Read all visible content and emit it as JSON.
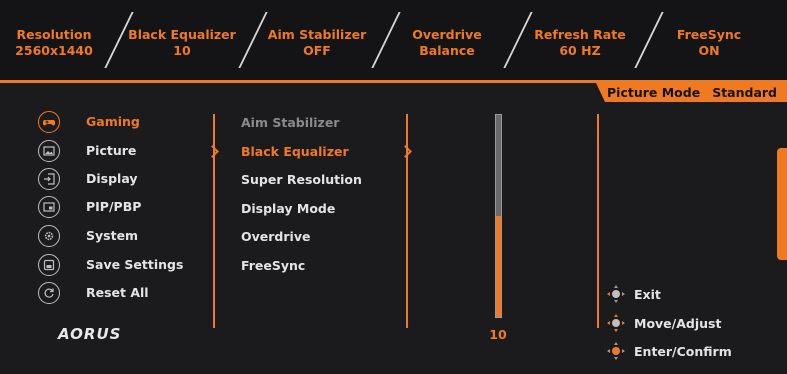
{
  "status_bar": [
    {
      "label": "Resolution",
      "value": "2560x1440"
    },
    {
      "label": "Black Equalizer",
      "value": "10"
    },
    {
      "label": "Aim Stabilizer",
      "value": "OFF"
    },
    {
      "label": "Overdrive",
      "value": "Balance"
    },
    {
      "label": "Refresh Rate",
      "value": "60 HZ"
    },
    {
      "label": "FreeSync",
      "value": "ON"
    }
  ],
  "picture_mode": {
    "label": "Picture Mode",
    "value": "Standard"
  },
  "main_menu": [
    {
      "label": "Gaming",
      "icon": "gamepad-icon",
      "active": true
    },
    {
      "label": "Picture",
      "icon": "picture-icon",
      "active": false
    },
    {
      "label": "Display",
      "icon": "display-input-icon",
      "active": false
    },
    {
      "label": "PIP/PBP",
      "icon": "pip-icon",
      "active": false
    },
    {
      "label": "System",
      "icon": "gear-icon",
      "active": false
    },
    {
      "label": "Save Settings",
      "icon": "save-icon",
      "active": false
    },
    {
      "label": "Reset All",
      "icon": "reset-icon",
      "active": false
    }
  ],
  "sub_menu": [
    {
      "label": "Aim Stabilizer",
      "state": "disabled"
    },
    {
      "label": "Black Equalizer",
      "state": "active"
    },
    {
      "label": "Super Resolution",
      "state": "normal"
    },
    {
      "label": "Display Mode",
      "state": "normal"
    },
    {
      "label": "Overdrive",
      "state": "normal"
    },
    {
      "label": "FreeSync",
      "state": "normal"
    }
  ],
  "slider": {
    "value": "10",
    "level_fraction": 0.5
  },
  "hints": [
    {
      "label": "Exit",
      "icon": "joystick-left-icon"
    },
    {
      "label": "Move/Adjust",
      "icon": "joystick-move-icon"
    },
    {
      "label": "Enter/Confirm",
      "icon": "joystick-press-icon"
    }
  ],
  "brand_logo": "AORUS",
  "colors": {
    "accent": "#f07a22",
    "background": "#1b1b1d",
    "text": "#e4e4e4",
    "disabled": "#8a8a8a"
  }
}
